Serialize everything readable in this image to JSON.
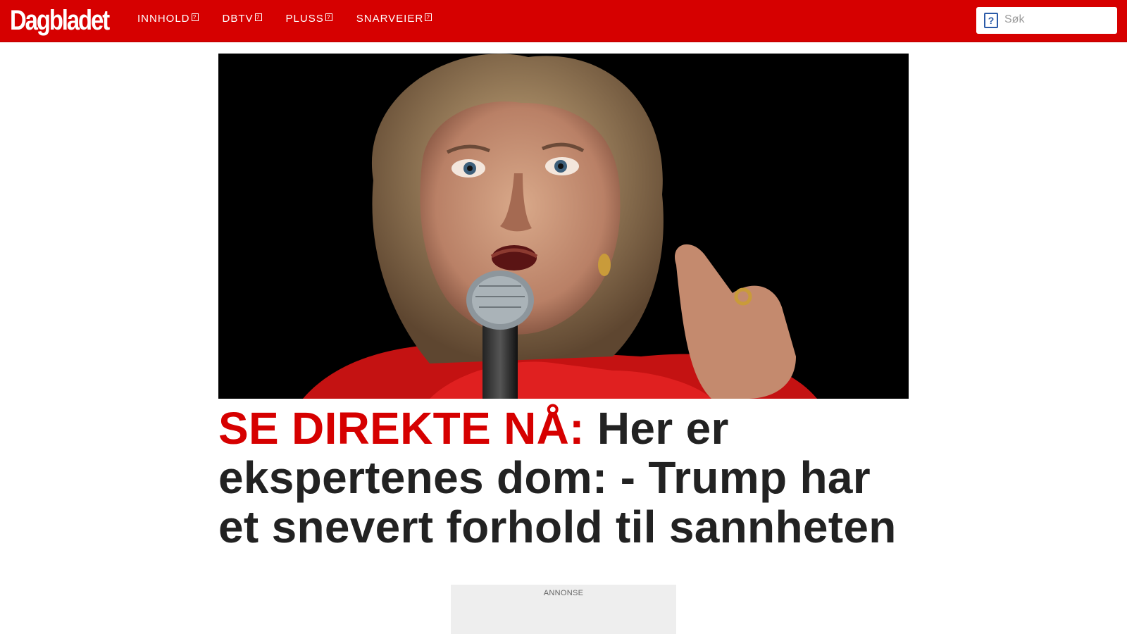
{
  "header": {
    "logo_text": "Dagbladet",
    "nav": [
      {
        "label": "INNHOLD",
        "icon": "chevron-down-icon"
      },
      {
        "label": "DBTV",
        "icon": "chevron-down-icon"
      },
      {
        "label": "PLUSS",
        "icon": "chevron-down-icon"
      },
      {
        "label": "SNARVEIER",
        "icon": "chevron-down-icon"
      }
    ],
    "search": {
      "placeholder": "Søk",
      "value": "",
      "icon": "search-icon"
    }
  },
  "article": {
    "image_icon": "hero-photo",
    "kicker": "SE DIREKTE NÅ:",
    "title": "Her er ekspertenes dom: - Trump har et snevert forhold til sannheten"
  },
  "ad": {
    "label": "ANNONSE"
  },
  "colors": {
    "brand_red": "#d60000",
    "headline_text": "#222222",
    "search_icon_blue": "#2a5aa8",
    "ad_background": "#eeeeee"
  }
}
